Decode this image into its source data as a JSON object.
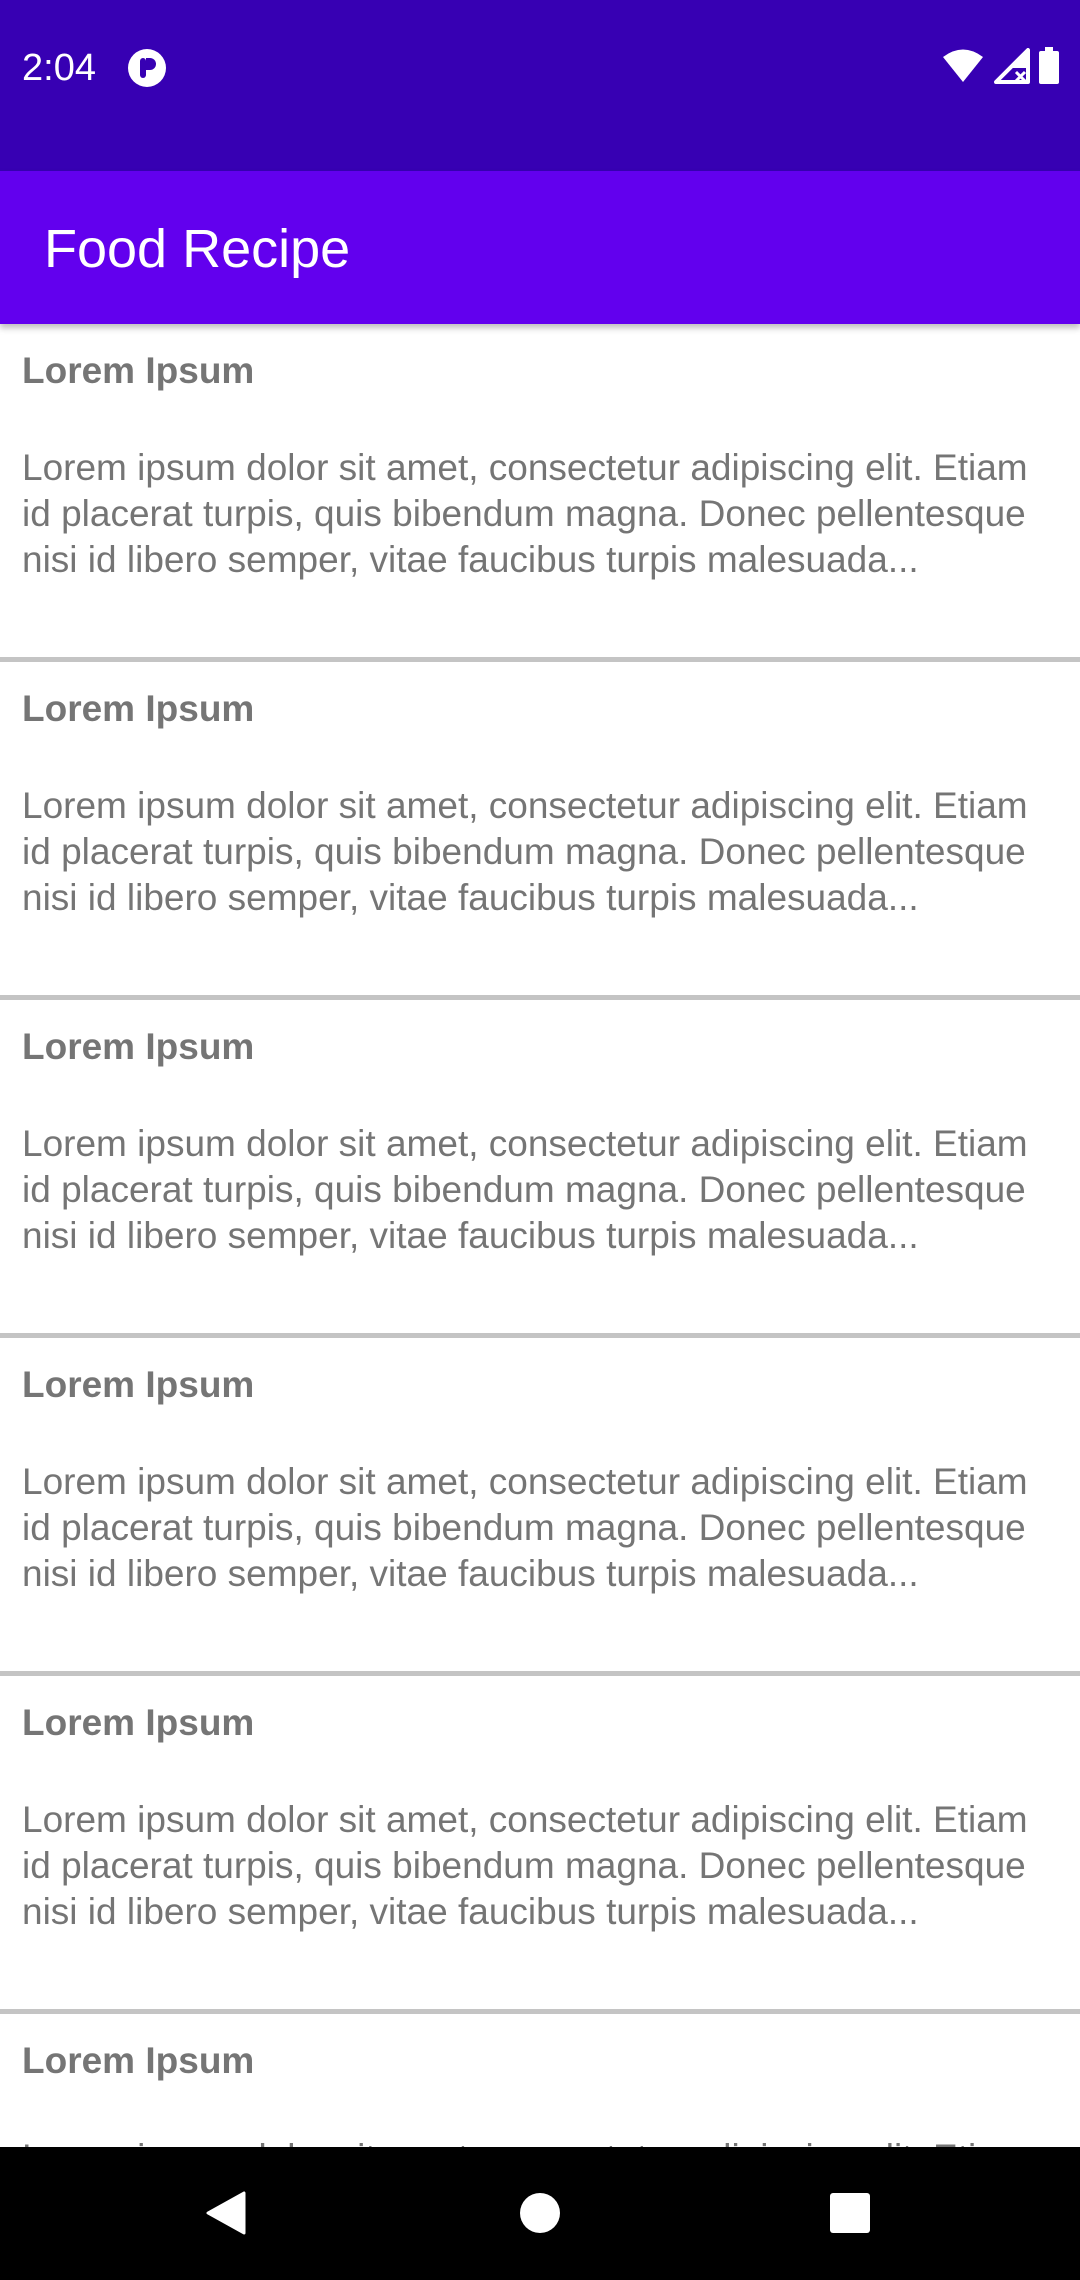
{
  "status_bar": {
    "time": "2:04",
    "app_icon": "app-notification-icon",
    "icons": [
      "wifi-icon",
      "signal-icon",
      "battery-icon"
    ]
  },
  "app_bar": {
    "title": "Food Recipe"
  },
  "recipes": [
    {
      "title": "Lorem Ipsum",
      "description": "Lorem ipsum dolor sit amet, consectetur adipiscing elit. Etiam id placerat turpis, quis bibendum magna. Donec pellentesque nisi id libero semper, vitae faucibus turpis malesuada..."
    },
    {
      "title": "Lorem Ipsum",
      "description": "Lorem ipsum dolor sit amet, consectetur adipiscing elit. Etiam id placerat turpis, quis bibendum magna. Donec pellentesque nisi id libero semper, vitae faucibus turpis malesuada..."
    },
    {
      "title": "Lorem Ipsum",
      "description": "Lorem ipsum dolor sit amet, consectetur adipiscing elit. Etiam id placerat turpis, quis bibendum magna. Donec pellentesque nisi id libero semper, vitae faucibus turpis malesuada..."
    },
    {
      "title": "Lorem Ipsum",
      "description": "Lorem ipsum dolor sit amet, consectetur adipiscing elit. Etiam id placerat turpis, quis bibendum magna. Donec pellentesque nisi id libero semper, vitae faucibus turpis malesuada..."
    },
    {
      "title": "Lorem Ipsum",
      "description": "Lorem ipsum dolor sit amet, consectetur adipiscing elit. Etiam id placerat turpis, quis bibendum magna. Donec pellentesque nisi id libero semper, vitae faucibus turpis malesuada..."
    },
    {
      "title": "Lorem Ipsum",
      "description": "Lorem ipsum dolor sit amet, consectetur adipiscing elit. Etiam id placerat turpis, quis bibendum magna. Donec pellentesque nisi id libero semper, vitae faucibus turpis malesuada..."
    }
  ],
  "nav_bar": {
    "buttons": [
      "back-icon",
      "home-icon",
      "recents-icon"
    ]
  },
  "colors": {
    "status_bar": "#3700b3",
    "app_bar": "#6200ee",
    "list_text": "#757575",
    "divider": "#c4c4c4",
    "nav_bar": "#000000"
  }
}
